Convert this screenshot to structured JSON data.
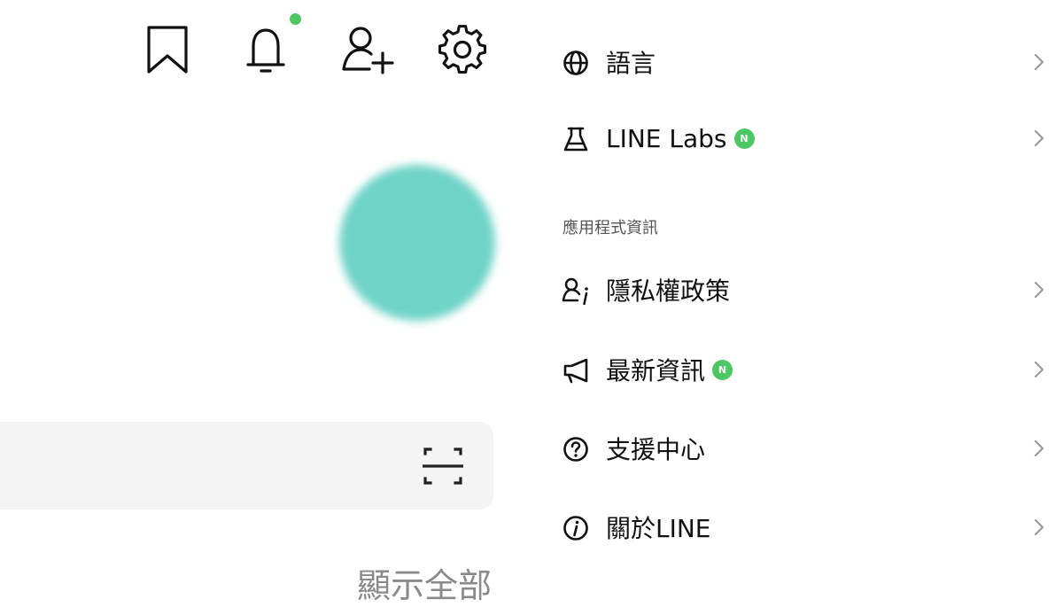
{
  "colors": {
    "accent_green": "#4cc764",
    "avatar": "#6fd3c8",
    "icon_stroke": "#111111",
    "chevron": "#9a9a9a",
    "secondary_text": "#8a8a8a"
  },
  "toolbar": {
    "icons": [
      "bookmark-icon",
      "bell-icon",
      "add-friend-icon",
      "gear-icon"
    ],
    "notification_dot": true
  },
  "profile": {
    "avatar_color": "#6fd3c8"
  },
  "search": {
    "scan_icon": "qr-scan-icon"
  },
  "show_all": "顯示全部",
  "settings": {
    "rows_top": [
      {
        "key": "language",
        "label": "語言",
        "icon": "globe-icon",
        "badge": false
      },
      {
        "key": "labs",
        "label": "LINE Labs",
        "icon": "flask-icon",
        "badge": true,
        "badge_text": "N"
      }
    ],
    "section_header": "應用程式資訊",
    "rows_info": [
      {
        "key": "privacy",
        "label": "隱私權政策",
        "icon": "privacy-icon",
        "badge": false
      },
      {
        "key": "news",
        "label": "最新資訊",
        "icon": "megaphone-icon",
        "badge": true,
        "badge_text": "N"
      },
      {
        "key": "help",
        "label": "支援中心",
        "icon": "help-icon",
        "badge": false
      },
      {
        "key": "about",
        "label": "關於LINE",
        "icon": "info-icon",
        "badge": false
      }
    ]
  }
}
